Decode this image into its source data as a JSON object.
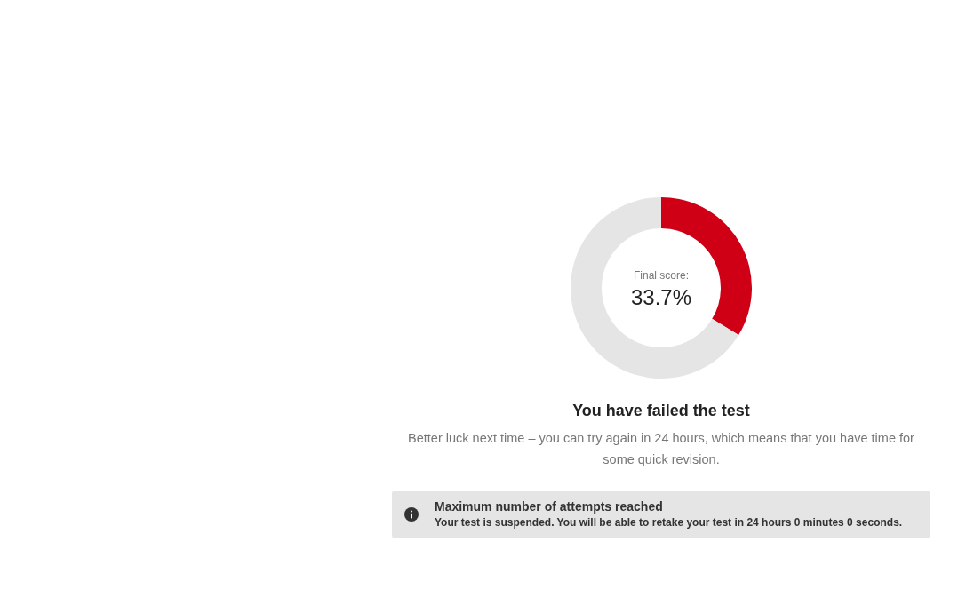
{
  "score_chart": {
    "label": "Final score:",
    "score": "33.7%",
    "chart_data": {
      "type": "donut",
      "values": [
        33.7,
        66.3
      ],
      "colors": [
        "#cf0016",
        "#e4e5e4"
      ]
    }
  },
  "result": {
    "title": "You have failed the test",
    "message": "Better luck next time – you can try again in 24 hours, which means that you have time for some quick revision."
  },
  "notice": {
    "title": "Maximum number of attempts reached",
    "message": "Your test is suspended. You will be able to retake your test in 24 hours 0 minutes 0 seconds."
  }
}
